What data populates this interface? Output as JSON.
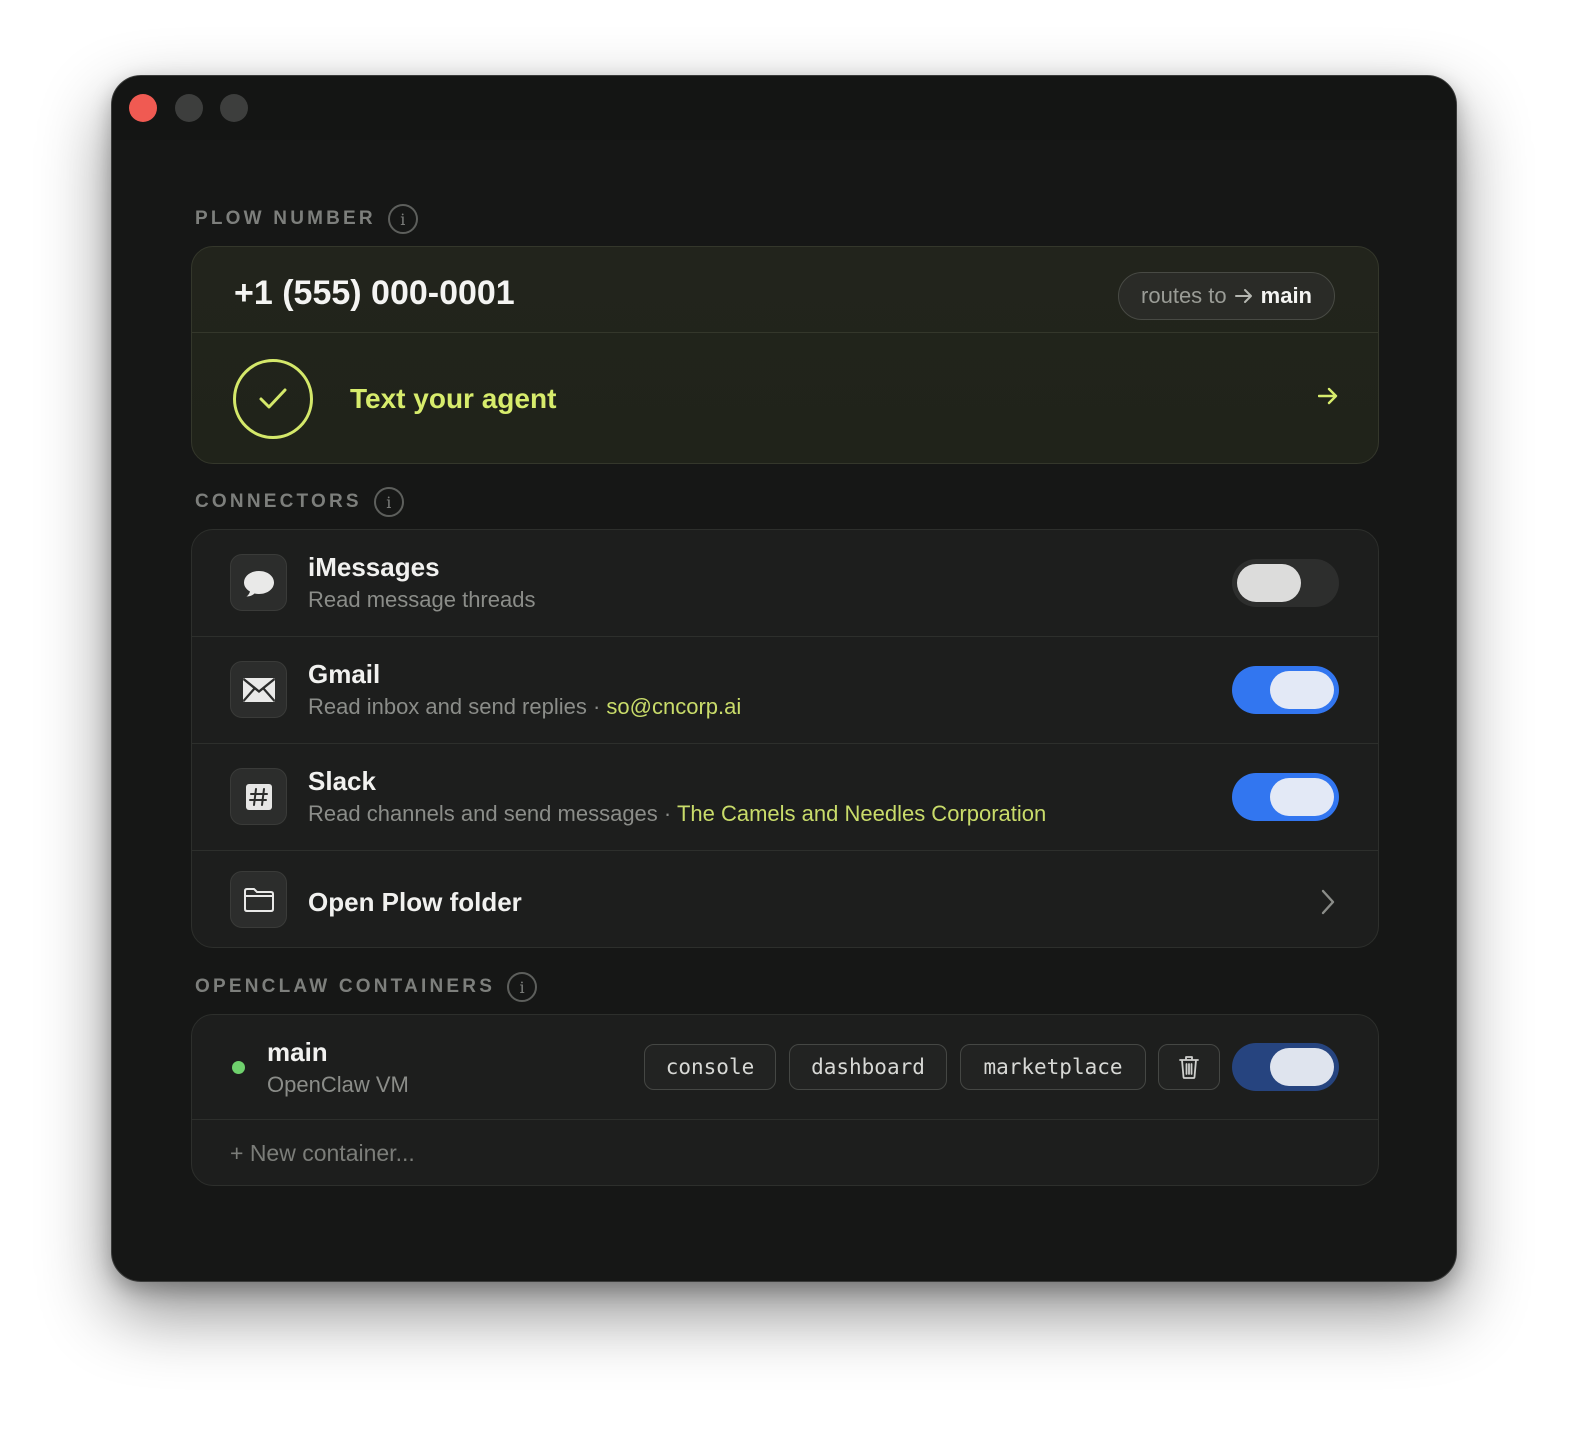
{
  "window": {
    "traffic_lights": [
      "close",
      "minimize",
      "maximize"
    ]
  },
  "plow_number": {
    "section_label": "PLOW NUMBER",
    "info_icon": "i",
    "phone": "+1 (555) 000-0001",
    "routes_prefix": "routes to",
    "routes_target": "main",
    "action_label": "Text your agent"
  },
  "connectors": {
    "section_label": "CONNECTORS",
    "info_icon": "i",
    "items": [
      {
        "title": "iMessages",
        "subtitle": "Read message threads",
        "detail": "",
        "enabled": false,
        "icon": "speech-bubble-icon"
      },
      {
        "title": "Gmail",
        "subtitle": "Read inbox and send replies · ",
        "detail": "so@cncorp.ai",
        "enabled": true,
        "icon": "envelope-icon"
      },
      {
        "title": "Slack",
        "subtitle": "Read channels and send messages · ",
        "detail": "The Camels and Needles Corporation",
        "enabled": true,
        "icon": "hash-icon"
      }
    ],
    "folder": {
      "title": "Open Plow folder",
      "icon": "folder-icon"
    }
  },
  "containers": {
    "section_label": "OPENCLAW CONTAINERS",
    "info_icon": "i",
    "items": [
      {
        "name": "main",
        "subtitle": "OpenClaw VM",
        "status": "running",
        "buttons": [
          "console",
          "dashboard",
          "marketplace"
        ],
        "enabled": true
      }
    ],
    "new_label": "+ New container..."
  },
  "colors": {
    "accent_lime": "#d7ec6c",
    "toggle_on": "#3276f0",
    "status_green": "#6fd16d",
    "close_red": "#f05a52"
  }
}
